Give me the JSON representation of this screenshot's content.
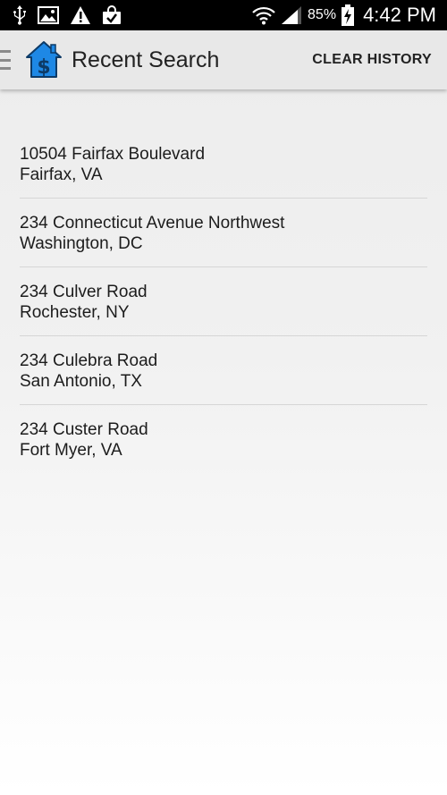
{
  "status_bar": {
    "icons": [
      "usb-icon",
      "image-icon",
      "warning-icon",
      "shopping-bag-icon"
    ],
    "battery_percent": "85%",
    "time": "4:42 PM"
  },
  "action_bar": {
    "title": "Recent Search",
    "clear_label": "CLEAR HISTORY"
  },
  "history": [
    {
      "street": "10504 Fairfax Boulevard",
      "city": "Fairfax, VA"
    },
    {
      "street": "234 Connecticut Avenue Northwest",
      "city": "Washington, DC"
    },
    {
      "street": "234 Culver Road",
      "city": "Rochester, NY"
    },
    {
      "street": "234 Culebra Road",
      "city": "San Antonio, TX"
    },
    {
      "street": "234 Custer Road",
      "city": "Fort Myer, VA"
    }
  ],
  "colors": {
    "app_icon_blue": "#1e88e5",
    "status_bar_bg": "#000000",
    "action_bar_bg": "#e8e8e8"
  }
}
